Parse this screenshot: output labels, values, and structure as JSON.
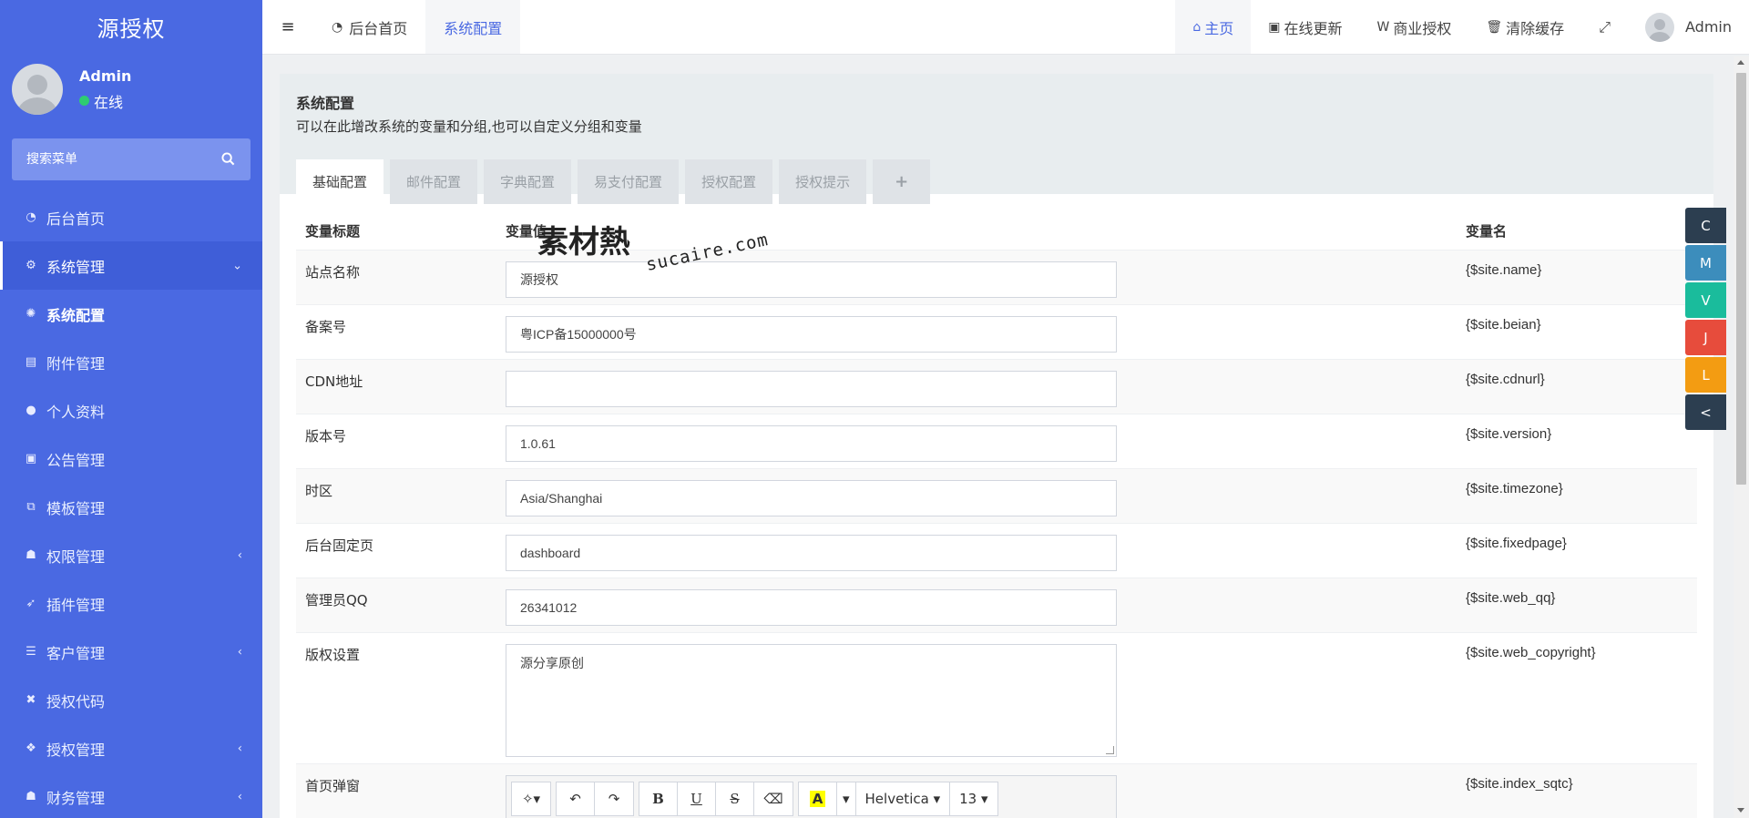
{
  "brand": "源授权",
  "user": {
    "name": "Admin",
    "status": "在线"
  },
  "search": {
    "placeholder": "搜索菜单"
  },
  "menu": [
    {
      "label": "后台首页",
      "icon": "dashboard-icon"
    },
    {
      "label": "系统管理",
      "icon": "cogs-icon"
    },
    {
      "label": "系统配置",
      "icon": "cog-icon"
    },
    {
      "label": "附件管理",
      "icon": "file-icon"
    },
    {
      "label": "个人资料",
      "icon": "user-icon"
    },
    {
      "label": "公告管理",
      "icon": "notice-icon"
    },
    {
      "label": "模板管理",
      "icon": "template-icon"
    },
    {
      "label": "权限管理",
      "icon": "group-icon"
    },
    {
      "label": "插件管理",
      "icon": "rocket-icon"
    },
    {
      "label": "客户管理",
      "icon": "list-icon"
    },
    {
      "label": "授权代码",
      "icon": "code-icon"
    },
    {
      "label": "授权管理",
      "icon": "auth-icon"
    },
    {
      "label": "财务管理",
      "icon": "finance-icon"
    }
  ],
  "topbar": {
    "tabs": [
      {
        "label": "后台首页"
      },
      {
        "label": "系统配置"
      }
    ],
    "links": [
      {
        "label": "主页"
      },
      {
        "label": "在线更新"
      },
      {
        "label": "商业授权"
      },
      {
        "label": "清除缓存"
      }
    ],
    "admin": "Admin"
  },
  "panel": {
    "title": "系统配置",
    "desc": "可以在此增改系统的变量和分组,也可以自定义分组和变量",
    "tabs": [
      "基础配置",
      "邮件配置",
      "字典配置",
      "易支付配置",
      "授权配置",
      "授权提示",
      "+"
    ]
  },
  "table": {
    "headers": [
      "变量标题",
      "变量值",
      "变量名"
    ],
    "rows": [
      {
        "title": "站点名称",
        "value": "源授权",
        "name": "{$site.name}"
      },
      {
        "title": "备案号",
        "value": "粤ICP备15000000号",
        "name": "{$site.beian}"
      },
      {
        "title": "CDN地址",
        "value": "",
        "name": "{$site.cdnurl}"
      },
      {
        "title": "版本号",
        "value": "1.0.61",
        "name": "{$site.version}"
      },
      {
        "title": "时区",
        "value": "Asia/Shanghai",
        "name": "{$site.timezone}"
      },
      {
        "title": "后台固定页",
        "value": "dashboard",
        "name": "{$site.fixedpage}"
      },
      {
        "title": "管理员QQ",
        "value": "26341012",
        "name": "{$site.web_qq}"
      },
      {
        "title": "版权设置",
        "value": "源分享原创",
        "name": "{$site.web_copyright}"
      },
      {
        "title": "首页弹窗",
        "value": "",
        "name": "{$site.index_sqtc}"
      }
    ]
  },
  "editor": {
    "font": "Helvetica",
    "size": "13"
  },
  "skins": [
    {
      "label": "C",
      "color": "#2c3e50"
    },
    {
      "label": "M",
      "color": "#3c8dbc"
    },
    {
      "label": "V",
      "color": "#1abc9c"
    },
    {
      "label": "J",
      "color": "#e74c3c"
    },
    {
      "label": "L",
      "color": "#f39c12"
    },
    {
      "label": "<",
      "color": "#2c3e50"
    }
  ],
  "watermark": {
    "cn": "素材熱",
    "en": "sucaire.com"
  },
  "colors": {
    "sidebar": "#4a69e2",
    "accent": "#4a69e2"
  }
}
